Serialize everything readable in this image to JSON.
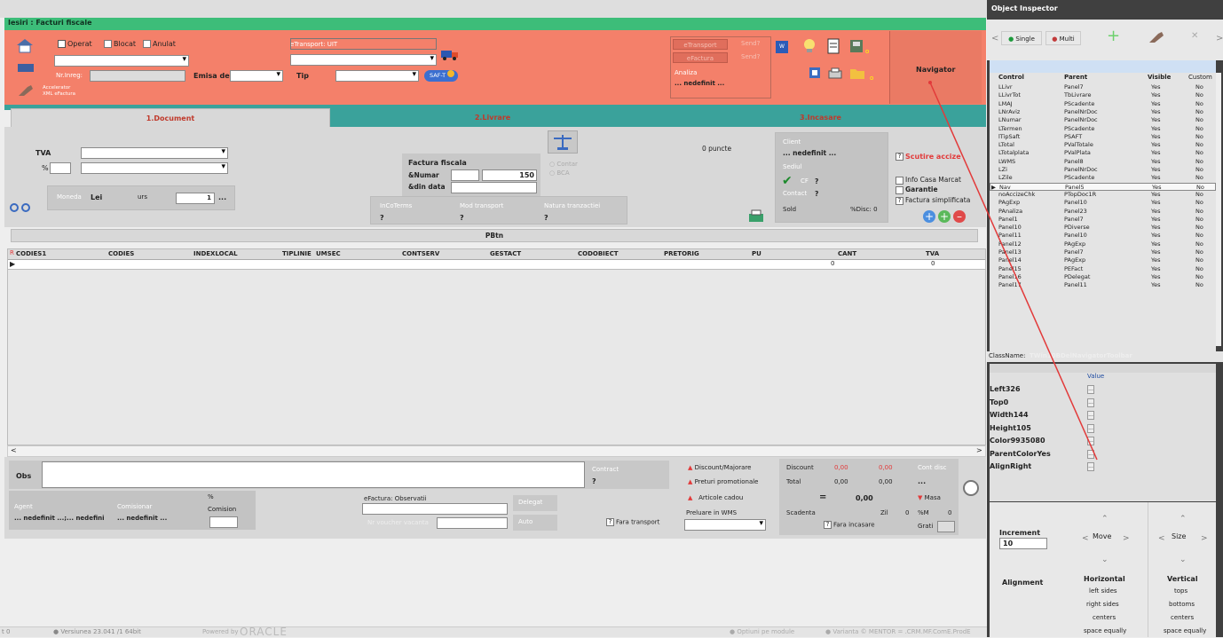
{
  "window": {
    "title": "Iesiri : Facturi fiscale"
  },
  "header": {
    "chk_operat": "Operat",
    "chk_blocat": "Blocat",
    "chk_anulat": "Anulat",
    "nr_inreg_label": "Nr.Inreg:",
    "emisa_de_label": "Emisa de",
    "accelerator_line1": "Accelerator",
    "accelerator_line2": "XML eFactura",
    "etransport_label": "eTransport: UIT",
    "tip_label": "Tip",
    "saft_label": "SAF-T",
    "etransport_btn": "eTransport",
    "send_label1": "Send?",
    "efactura_btn": "eFactura",
    "send_label2": "Send?",
    "analiza_label": "Analiza",
    "analiza_value": "... nedefinit ...",
    "small_o1": "o",
    "small_o2": "o",
    "navigator_label": "Navigator"
  },
  "tabs": [
    {
      "label": "1.Document"
    },
    {
      "label": "2.Livrare"
    },
    {
      "label": "3.Incasare"
    }
  ],
  "document": {
    "tva_label": "TVA",
    "pct_label": "%",
    "moneda_label": "Moneda",
    "moneda_value": "Lei",
    "curs_label": "urs",
    "curs_value": "1",
    "curs_dots": "...",
    "factura_title": "Factura fiscala",
    "numar_label": "&Numar",
    "numar_value": "150",
    "din_data_label": "&din data",
    "contar_label": "Contar",
    "bca_label": "BCA",
    "incoterms_label": "InCoTerms",
    "incoterms_value": "?",
    "mod_transport_label": "Mod transport",
    "mod_transport_value": "?",
    "natura_label": "Natura tranzactiei",
    "natura_value": "?",
    "puncte_label": "0 puncte",
    "client_label": "Client",
    "client_value": "... nedefinit ...",
    "sediul_label": "Sediul",
    "cf_label": "CF",
    "cf_value": "?",
    "contact_label": "Contact",
    "contact_value": "?",
    "sold_label": "Sold",
    "disc_label": "%Disc: 0",
    "scutire_label": "Scutire accize",
    "info_casa_label": "Info Casa Marcat",
    "garantie_label": "Garantie",
    "factura_simpl_label": "Factura simplificata",
    "pbtn_label": "PBtn"
  },
  "grid": {
    "columns": [
      "CODIES1",
      "CODIES",
      "INDEXLOCAL",
      "TIPLINIE",
      "UMSEC",
      "CONTSERV",
      "GESTACT",
      "CODOBIECT",
      "PRETORIG",
      "PU",
      "CANT",
      "TVA"
    ],
    "cant_value": "0",
    "tva_value": "0"
  },
  "bottom": {
    "obs_label": "Obs",
    "contract_label": "Contract",
    "contract_value": "?",
    "discount_majorare": "Discount/Majorare",
    "preturi_promo": "Preturi promotionale",
    "articole_cadou": "Articole cadou",
    "preluare_wms": "Preluare in WMS",
    "discount_label": "Discount",
    "discount_v1": "0,00",
    "discount_v2": "0,00",
    "total_label": "Total",
    "total_v1": "0,00",
    "total_v2": "0,00",
    "eq_sign": "=",
    "eq_value": "0,00",
    "scadenta_label": "Scadenta",
    "zil_label": "Zil",
    "zil_value": "0",
    "pm_label": "%M",
    "pm_value": "0",
    "fara_incasare": "Fara incasare",
    "grati_label": "Grati",
    "cont_disc_label": "Cont disc",
    "cont_disc_value": "...",
    "masa_label": "Masa",
    "agent_label": "Agent",
    "agent_value": "... nedefinit ...;... nedefini",
    "comisionar_label": "Comisionar",
    "comisionar_value": "... nedefinit ...",
    "comision_pct": "%",
    "comision_label": "Comision",
    "efactura_obs_label": "eFactura: Observatii",
    "delegat_label": "Delegat",
    "auto_label": "Auto",
    "voucher_label": "Nr voucher vacanta",
    "fara_transport": "Fara transport",
    "q_mark": "?"
  },
  "status_bar": {
    "item0": "t 0",
    "version": "Versiunea 23.041 /1 64bit",
    "powered": "Powered by",
    "oracle": "ORACLE",
    "optiuni": "Optiuni pe module",
    "varianta": "Varianta © MENTOR = .CRM.MF.ComE.ProdE"
  },
  "inspector": {
    "title": "Object Inspector",
    "single_label": "Single",
    "multi_label": "Multi",
    "col_control": "Control",
    "col_parent": "Parent",
    "col_visible": "Visible",
    "col_custom": "Custom",
    "rows": [
      [
        "LLivr",
        "Panel7",
        "Yes",
        "No"
      ],
      [
        "LLivrTot",
        "TbLivrare",
        "Yes",
        "No"
      ],
      [
        "LMAJ",
        "PScadente",
        "Yes",
        "No"
      ],
      [
        "LNrAviz",
        "PanelNrDoc",
        "Yes",
        "No"
      ],
      [
        "LNumar",
        "PanelNrDoc",
        "Yes",
        "No"
      ],
      [
        "LTermen",
        "PScadente",
        "Yes",
        "No"
      ],
      [
        "lTipSaft",
        "PSAFT",
        "Yes",
        "No"
      ],
      [
        "LTotal",
        "PValTotale",
        "Yes",
        "No"
      ],
      [
        "LTotalplata",
        "PValPlata",
        "Yes",
        "No"
      ],
      [
        "LWMS",
        "Panel8",
        "Yes",
        "No"
      ],
      [
        "LZi",
        "PanelNrDoc",
        "Yes",
        "No"
      ],
      [
        "LZile",
        "PScadente",
        "Yes",
        "No"
      ],
      [
        "Nav",
        "Panel5",
        "Yes",
        "No"
      ],
      [
        "noAccizeChk",
        "PTopDoc1R",
        "Yes",
        "No"
      ],
      [
        "PAgExp",
        "Panel10",
        "Yes",
        "No"
      ],
      [
        "PAnaliza",
        "Panel23",
        "Yes",
        "No"
      ],
      [
        "Panel1",
        "Panel7",
        "Yes",
        "No"
      ],
      [
        "Panel10",
        "PDiverse",
        "Yes",
        "No"
      ],
      [
        "Panel11",
        "Panel10",
        "Yes",
        "No"
      ],
      [
        "Panel12",
        "PAgExp",
        "Yes",
        "No"
      ],
      [
        "Panel13",
        "Panel7",
        "Yes",
        "No"
      ],
      [
        "Panel14",
        "PAgExp",
        "Yes",
        "No"
      ],
      [
        "Panel15",
        "PEFact",
        "Yes",
        "No"
      ],
      [
        "Panel16",
        "PDelegat",
        "Yes",
        "No"
      ],
      [
        "Panel17",
        "Panel11",
        "Yes",
        "No"
      ]
    ],
    "classname_label": "ClassName:",
    "classname_value": "TWin10BDelNavigatorToolbar",
    "value_header": "Value",
    "props": [
      [
        "Left",
        "326"
      ],
      [
        "Top",
        "0"
      ],
      [
        "Width",
        "144"
      ],
      [
        "Height",
        "105"
      ],
      [
        "Color",
        "9935080"
      ],
      [
        "ParentColor",
        "Yes"
      ],
      [
        "Align",
        "Right"
      ]
    ],
    "increment_label": "Increment",
    "increment_value": "10",
    "move_label": "Move",
    "size_label": "Size",
    "alignment_label": "Alignment",
    "horizontal_label": "Horizontal",
    "vertical_label": "Vertical",
    "h_opts": [
      "left sides",
      "right sides",
      "centers",
      "space equally"
    ],
    "v_opts": [
      "tops",
      "bottoms",
      "centers",
      "space equally"
    ]
  },
  "colors": {
    "title_green": "#3dbd79",
    "header_salmon": "#f4806a",
    "teal_bar": "#3aa29b",
    "inspector_dark": "#404040",
    "accent_red": "#e23a3a"
  }
}
